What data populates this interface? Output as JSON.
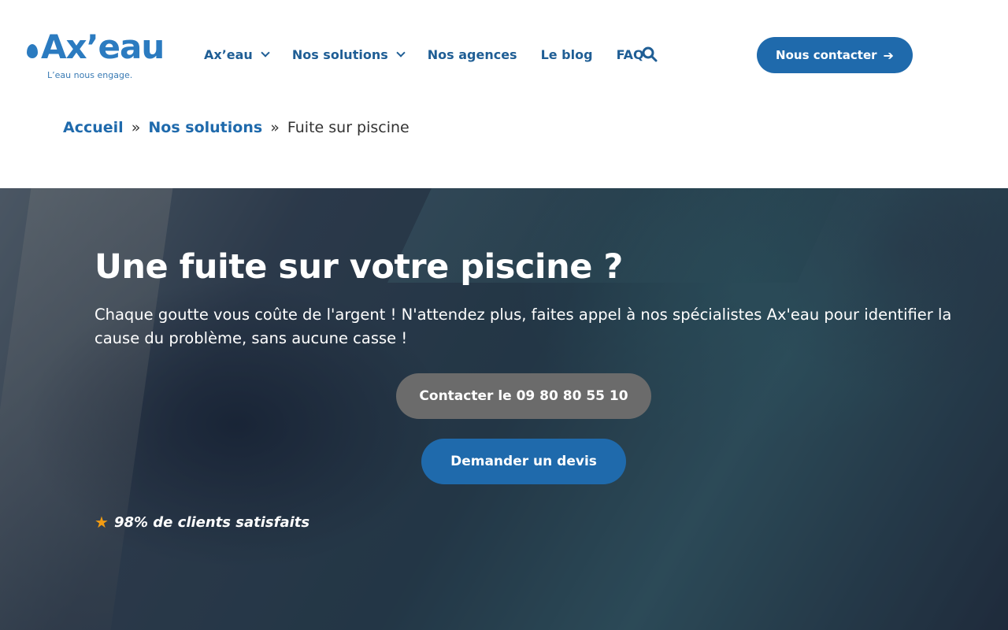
{
  "brand": {
    "logo_text": "Ax’eau",
    "tagline": "L’eau nous engage.",
    "accent_color": "#1f6aac"
  },
  "nav": {
    "items": [
      {
        "label": "Ax’eau",
        "has_dropdown": true
      },
      {
        "label": "Nos solutions",
        "has_dropdown": true
      },
      {
        "label": "Nos agences",
        "has_dropdown": false
      },
      {
        "label": "Le blog",
        "has_dropdown": false
      },
      {
        "label": "FAQ",
        "has_dropdown": false
      }
    ],
    "search_icon": "search-icon",
    "contact_label": "Nous contacter",
    "contact_icon": "arrow-right-icon"
  },
  "breadcrumb": {
    "home": "Accueil",
    "separator": "»",
    "section": "Nos solutions",
    "current": "Fuite sur piscine"
  },
  "hero": {
    "title": "Une fuite sur votre piscine ?",
    "text": "Chaque goutte vous coûte de l'argent ! N'attendez plus, faites appel à nos spécialistes Ax'eau pour identifier la cause du problème, sans aucune casse !",
    "call_button": "Contacter le 09 80 80 55 10",
    "call_button_color": "#6b6b6b",
    "quote_button": "Demander un devis",
    "rating_text": "98% de clients satisfaits",
    "rating_icon": "star-icon",
    "rating_icon_color": "#f39c12"
  }
}
